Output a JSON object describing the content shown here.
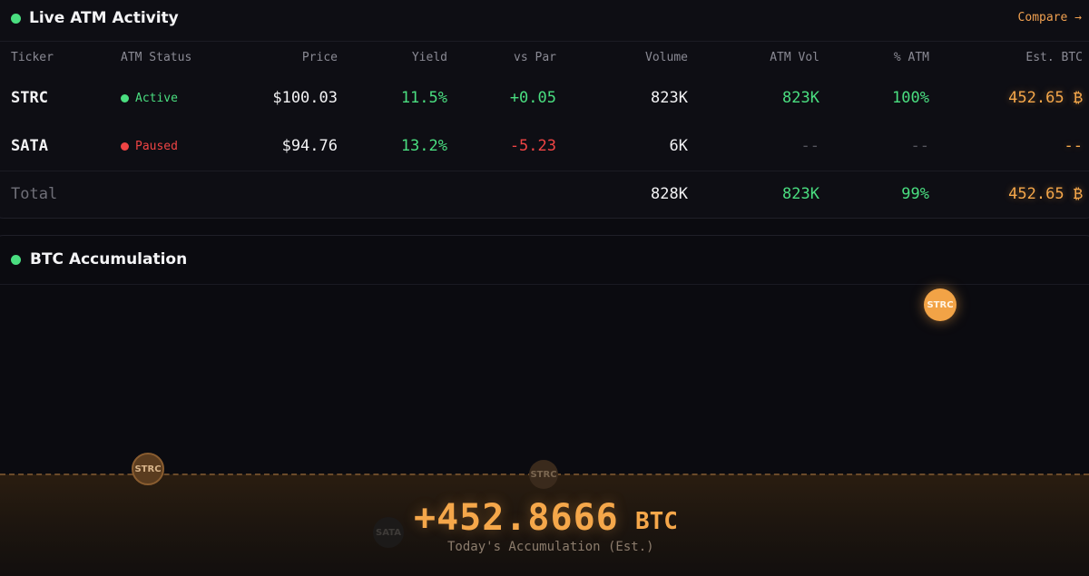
{
  "atm_panel": {
    "title": "Live ATM Activity",
    "compare_link": "Compare →",
    "columns": {
      "ticker": "Ticker",
      "status": "ATM Status",
      "price": "Price",
      "yield": "Yield",
      "vs_par": "vs Par",
      "volume": "Volume",
      "atm_vol": "ATM Vol",
      "pct_atm": "% ATM",
      "est_btc": "Est. BTC"
    },
    "rows": [
      {
        "ticker": "STRC",
        "status": "Active",
        "status_color": "#4ade80",
        "price": "$100.03",
        "yield": "11.5%",
        "vs_par": "+0.05",
        "volume": "823K",
        "atm_vol": "823K",
        "pct_atm": "100%",
        "est_btc": "452.65 ₿"
      },
      {
        "ticker": "SATA",
        "status": "Paused",
        "status_color": "#ef4444",
        "price": "$94.76",
        "yield": "13.2%",
        "vs_par": "-5.23",
        "volume": "6K",
        "atm_vol": "--",
        "pct_atm": "--",
        "est_btc": "--"
      }
    ],
    "total": {
      "label": "Total",
      "volume": "828K",
      "atm_vol": "823K",
      "pct_atm": "99%",
      "est_btc": "452.65 ₿"
    }
  },
  "accumulation_panel": {
    "title": "BTC Accumulation",
    "bubbles": [
      {
        "label": "STRC"
      },
      {
        "label": "STRC"
      },
      {
        "label": "STRC"
      },
      {
        "label": "SATA"
      }
    ],
    "value": "+452.8666",
    "unit": "BTC",
    "caption": "Today's Accumulation (Est.)"
  },
  "colors": {
    "accent": "#f5a74a",
    "positive": "#4ade80",
    "negative": "#ef4444",
    "background": "#0b0b10"
  }
}
